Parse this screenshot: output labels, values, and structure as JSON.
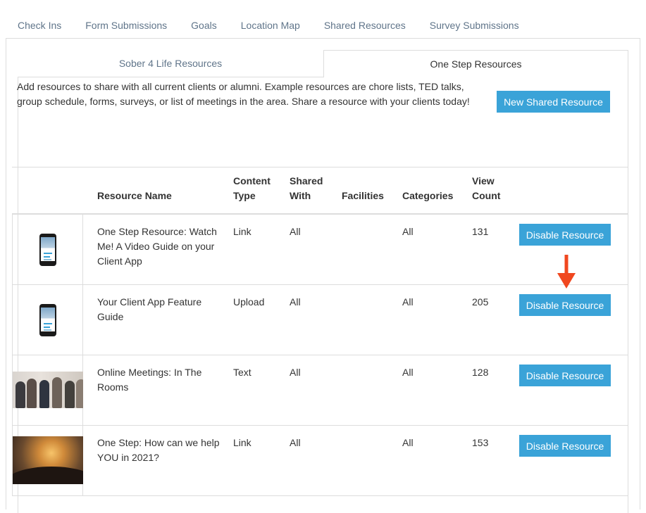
{
  "top_tabs": [
    "Check Ins",
    "Form Submissions",
    "Goals",
    "Location Map",
    "Shared Resources",
    "Survey Submissions"
  ],
  "sub_tabs": {
    "inactive": "Sober 4 Life Resources",
    "active": "One Step Resources"
  },
  "intro_text": "Add resources to share with all current clients or alumni. Example resources are chore lists, TED talks, group schedule, forms, surveys, or list of meetings in the area. Share a resource with your clients today!",
  "new_button_label": "New Shared Resource",
  "table": {
    "headers": {
      "name": "Resource Name",
      "content_type": "Content Type",
      "shared_with": "Shared With",
      "facilities": "Facilities",
      "categories": "Categories",
      "view_count": "View Count"
    },
    "rows": [
      {
        "thumb": "phone-app-icon",
        "name": "One Step Resource: Watch Me! A Video Guide on your Client App",
        "content_type": "Link",
        "shared_with": "All",
        "facilities": "",
        "categories": "All",
        "view_count": "131",
        "action": "Disable Resource"
      },
      {
        "thumb": "phone-app-icon",
        "name": "Your Client App Feature Guide",
        "content_type": "Upload",
        "shared_with": "All",
        "facilities": "",
        "categories": "All",
        "view_count": "205",
        "action": "Disable Resource"
      },
      {
        "thumb": "group-meeting-photo",
        "name": "Online Meetings: In The Rooms",
        "content_type": "Text",
        "shared_with": "All",
        "facilities": "",
        "categories": "All",
        "view_count": "128",
        "action": "Disable Resource"
      },
      {
        "thumb": "sunset-helping-hand-photo",
        "name": "One Step: How can we help YOU in 2021?",
        "content_type": "Link",
        "shared_with": "All",
        "facilities": "",
        "categories": "All",
        "view_count": "153",
        "action": "Disable Resource"
      }
    ]
  },
  "colors": {
    "accent": "#3aa3d8",
    "arrow": "#f0471f",
    "border": "#dddddd",
    "muted_text": "#60758a"
  }
}
